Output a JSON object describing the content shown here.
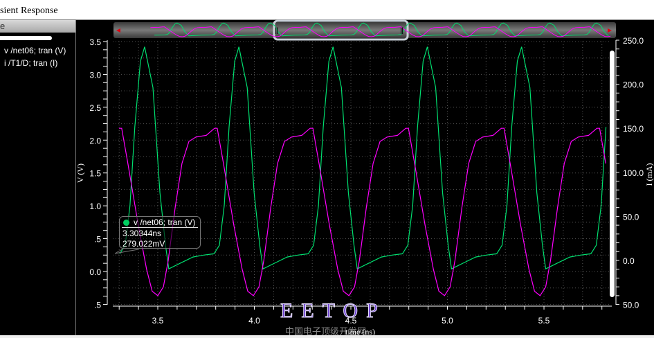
{
  "window": {
    "title": "sient Response"
  },
  "panel": {
    "header": "e",
    "legend": [
      {
        "label": "v /net06; tran (V)",
        "color": "#00e070"
      },
      {
        "label": "i /T1/D; tran (I)",
        "color": "#ff00ff"
      }
    ]
  },
  "tooltip": {
    "trace": "v /net06; tran (V)",
    "x_value": "3.30344ns",
    "y_value": "279.022mV"
  },
  "watermark": {
    "text": "EETOP",
    "subtext": "中国电子顶级开发网"
  },
  "chart_data": {
    "type": "line",
    "xlabel": "time (ns)",
    "ylabel_left": "V (V)",
    "ylabel_right": "I (mA)",
    "xlim": [
      3.267,
      5.844
    ],
    "ylim_left": [
      -0.5,
      3.5
    ],
    "ylim_right": [
      -50,
      250
    ],
    "x_ticks": [
      "3.5",
      "4.0",
      "4.5",
      "5.0",
      "5.5"
    ],
    "x_tick_values": [
      3.5,
      4.0,
      4.5,
      5.0,
      5.5
    ],
    "y_left_ticks": [
      "3.5",
      "3.0",
      "2.5",
      "2.0",
      "1.5",
      "1.0",
      ".5",
      "0.0",
      ".5"
    ],
    "y_left_tick_values": [
      3.5,
      3.0,
      2.5,
      2.0,
      1.5,
      1.0,
      0.5,
      0.0,
      -0.5
    ],
    "y_right_ticks": [
      "250.0",
      "200.0",
      "150.0",
      "100.0",
      "50.0",
      "0.0",
      "50.0"
    ],
    "y_right_tick_values": [
      250,
      200,
      150,
      100,
      50,
      0,
      -50
    ],
    "grid": true,
    "series": [
      {
        "name": "v /net06; tran (V)",
        "axis": "left",
        "color": "#00e070",
        "period_ns": 0.488,
        "phase_ns": 3.432,
        "one_period": [
          [
            0,
            3.42
          ],
          [
            0.043,
            2.8
          ],
          [
            0.079,
            1.2
          ],
          [
            0.108,
            0.4
          ],
          [
            0.125,
            0.04
          ],
          [
            0.18,
            0.12
          ],
          [
            0.25,
            0.22
          ],
          [
            0.305,
            0.25
          ],
          [
            0.359,
            0.27
          ],
          [
            0.387,
            0.4
          ],
          [
            0.412,
            1.0
          ],
          [
            0.437,
            2.2
          ],
          [
            0.466,
            3.2
          ],
          [
            0.488,
            3.42
          ]
        ]
      },
      {
        "name": "i /T1/D; tran (I)",
        "axis": "right",
        "color": "#ff00ff",
        "period_ns": 0.495,
        "phase_ns": 3.5,
        "one_period": [
          [
            0,
            -40
          ],
          [
            0.029,
            -30
          ],
          [
            0.054,
            0
          ],
          [
            0.09,
            60
          ],
          [
            0.125,
            110
          ],
          [
            0.161,
            135
          ],
          [
            0.197,
            140
          ],
          [
            0.251,
            142
          ],
          [
            0.294,
            150
          ],
          [
            0.308,
            150
          ],
          [
            0.34,
            110
          ],
          [
            0.394,
            40
          ],
          [
            0.437,
            -10
          ],
          [
            0.466,
            -35
          ],
          [
            0.495,
            -40
          ]
        ]
      }
    ]
  }
}
